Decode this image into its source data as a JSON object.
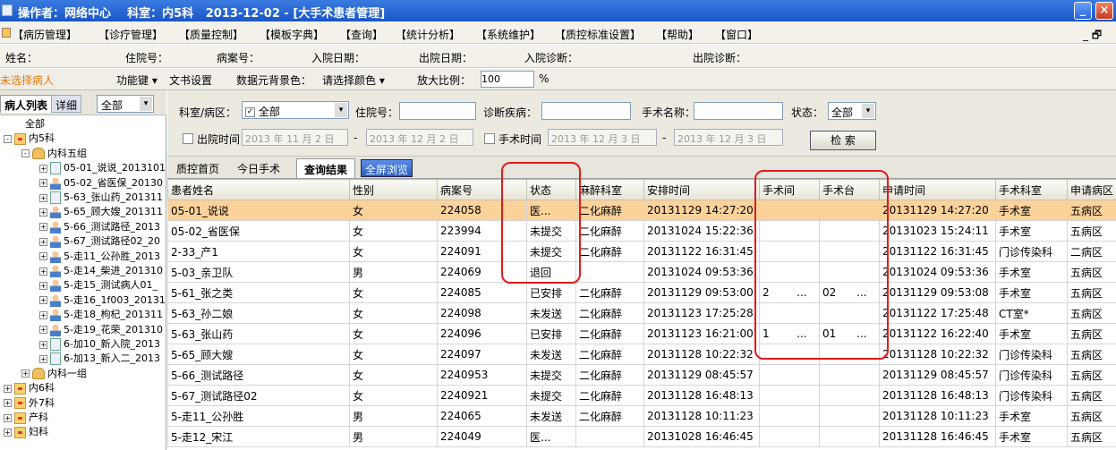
{
  "window": {
    "title": "操作者：网络中心    科室：内5科   2013-12-02 - [大手术患者管理]",
    "min_glyph": "_",
    "close_glyph": "×"
  },
  "menu": {
    "items": [
      "【病历管理】",
      "【诊疗管理】",
      "【质量控制】",
      "【模板字典】",
      "【查询】",
      "【统计分析】",
      "【系统维护】",
      "【质控标准设置】",
      "【帮助】",
      "【窗口】"
    ],
    "right_glyph": "_ 🗗"
  },
  "info": {
    "name": "姓名：",
    "inpatient_no": "住院号：",
    "record_no": "病案号：",
    "admit_date": "入院日期：",
    "discharge_date": "出院日期：",
    "admit_diag": "入院诊断：",
    "discharge_diag": "出院诊断："
  },
  "toolrow": {
    "unselected": "未选择病人",
    "function_key": "功能键",
    "doc_settings": "文书设置",
    "bg_color_label": "数据元背景色：",
    "bg_color_value": "请选择颜色",
    "zoom_label": "放大比例：",
    "zoom_value": "100",
    "zoom_unit": "%"
  },
  "left": {
    "tab_list": "病人列表",
    "tab_detail": "详细",
    "filter": "全部",
    "tree": [
      {
        "label": "全部",
        "level": 0,
        "icon": "none"
      },
      {
        "label": "内5科",
        "level": 0,
        "icon": "dept",
        "exp": "-"
      },
      {
        "label": "内科五组",
        "level": 1,
        "icon": "group",
        "exp": "-"
      },
      {
        "label": "05-01_说说_2013101",
        "level": 2,
        "icon": "bed",
        "exp": "+"
      },
      {
        "label": "05-02_省医保_20130",
        "level": 2,
        "icon": "pat",
        "exp": "+"
      },
      {
        "label": "5-63_张山药_201311",
        "level": 2,
        "icon": "bed",
        "exp": "+"
      },
      {
        "label": "5-65_顾大嫂_201311",
        "level": 2,
        "icon": "pat",
        "exp": "+"
      },
      {
        "label": "5-66_测试路径_2013",
        "level": 2,
        "icon": "pat",
        "exp": "+"
      },
      {
        "label": "5-67_测试路径02_20",
        "level": 2,
        "icon": "pat",
        "exp": "+"
      },
      {
        "label": "5-走11_公孙胜_2013",
        "level": 2,
        "icon": "pat",
        "exp": "+"
      },
      {
        "label": "5-走14_柴进_201310",
        "level": 2,
        "icon": "pat",
        "exp": "+"
      },
      {
        "label": "5-走15_测试病人01_",
        "level": 2,
        "icon": "pat",
        "exp": "+"
      },
      {
        "label": "5-走16_1f003_20131",
        "level": 2,
        "icon": "pat",
        "exp": "+"
      },
      {
        "label": "5-走18_枸杞_201311",
        "level": 2,
        "icon": "pat",
        "exp": "+"
      },
      {
        "label": "5-走19_花荣_201310",
        "level": 2,
        "icon": "pat",
        "exp": "+"
      },
      {
        "label": "6-加10_新入院_2013",
        "level": 2,
        "icon": "bed",
        "exp": "+"
      },
      {
        "label": "6-加13_新入二_2013",
        "level": 2,
        "icon": "bed",
        "exp": "+"
      },
      {
        "label": "内科一组",
        "level": 1,
        "icon": "group",
        "exp": "+"
      },
      {
        "label": "内6科",
        "level": 0,
        "icon": "dept",
        "exp": "+"
      },
      {
        "label": "外7科",
        "level": 0,
        "icon": "dept",
        "exp": "+"
      },
      {
        "label": "产科",
        "level": 0,
        "icon": "dept",
        "exp": "+"
      },
      {
        "label": "妇科",
        "level": 0,
        "icon": "dept",
        "exp": "+"
      }
    ]
  },
  "search": {
    "dept_label": "科室/病区：",
    "dept_value": "全部",
    "inpatient_label": "住院号：",
    "diag_label": "诊断疾病：",
    "surgery_label": "手术名称：",
    "status_label": "状态：",
    "status_value": "全部",
    "discharge_time": "出院时间",
    "discharge_from": "2013 年 11 月 2 日",
    "discharge_to": "2013 年 12 月 2 日",
    "surgery_time": "手术时间",
    "surgery_from": "2013 年 12 月 3 日",
    "surgery_to": "2013 年 12 月 3 日",
    "dash": "-",
    "search_btn": "检  索"
  },
  "tabs": [
    "质控首页",
    "今日手术",
    "查询结果",
    "全屏浏览"
  ],
  "grid": {
    "columns": [
      "患者姓名",
      "性别",
      "病案号",
      "状态",
      "麻醉科室",
      "安排时间",
      "手术间",
      "手术台",
      "申请时间",
      "手术科室",
      "申请病区"
    ],
    "rows": [
      [
        "05-01_说说",
        "女",
        "224058",
        "医...",
        "二化麻醉",
        "20131129 14:27:20",
        "",
        "",
        "20131129 14:27:20",
        "手术室",
        "五病区"
      ],
      [
        "05-02_省医保",
        "女",
        "223994",
        "未提交",
        "二化麻醉",
        "20131024 15:22:36",
        "",
        "",
        "20131023 15:24:11",
        "手术室",
        "五病区"
      ],
      [
        "2-33_产1",
        "女",
        "224091",
        "未提交",
        "二化麻醉",
        "20131122 16:31:45",
        "",
        "",
        "20131122 16:31:45",
        "门诊传染科",
        "二病区"
      ],
      [
        "5-03_亲卫队",
        "男",
        "224069",
        "退回",
        "",
        "20131024 09:53:36",
        "",
        "",
        "20131024 09:53:36",
        "手术室",
        "五病区"
      ],
      [
        "5-61_张之类",
        "女",
        "224085",
        "已安排",
        "二化麻醉",
        "20131129 09:53:00",
        "2        ...",
        "02      ...",
        "20131129 09:53:08",
        "手术室",
        "五病区"
      ],
      [
        "5-63_孙二娘",
        "女",
        "224098",
        "未发送",
        "二化麻醉",
        "20131123 17:25:28",
        "",
        "",
        "20131122 17:25:48",
        "CT室*",
        "五病区"
      ],
      [
        "5-63_张山药",
        "女",
        "224096",
        "已安排",
        "二化麻醉",
        "20131123 16:21:00",
        "1        ...",
        "01      ...",
        "20131122 16:22:40",
        "手术室",
        "五病区"
      ],
      [
        "5-65_顾大嫂",
        "女",
        "224097",
        "未发送",
        "二化麻醉",
        "20131128 10:22:32",
        "",
        "",
        "20131128 10:22:32",
        "门诊传染科",
        "五病区"
      ],
      [
        "5-66_测试路径",
        "女",
        "2240953",
        "未提交",
        "二化麻醉",
        "20131129 08:45:57",
        "",
        "",
        "20131129 08:45:57",
        "门诊传染科",
        "五病区"
      ],
      [
        "5-67_测试路径02",
        "女",
        "2240921",
        "未提交",
        "二化麻醉",
        "20131128 16:48:13",
        "",
        "",
        "20131128 16:48:13",
        "门诊传染科",
        "五病区"
      ],
      [
        "5-走11_公孙胜",
        "男",
        "224065",
        "未发送",
        "二化麻醉",
        "20131128 10:11:23",
        "",
        "",
        "20131128 10:11:23",
        "手术室",
        "五病区"
      ],
      [
        "5-走12_宋江",
        "男",
        "224049",
        "医...",
        "",
        "20131028 16:46:45",
        "",
        "",
        "20131128 16:46:45",
        "手术室",
        "五病区"
      ]
    ]
  }
}
